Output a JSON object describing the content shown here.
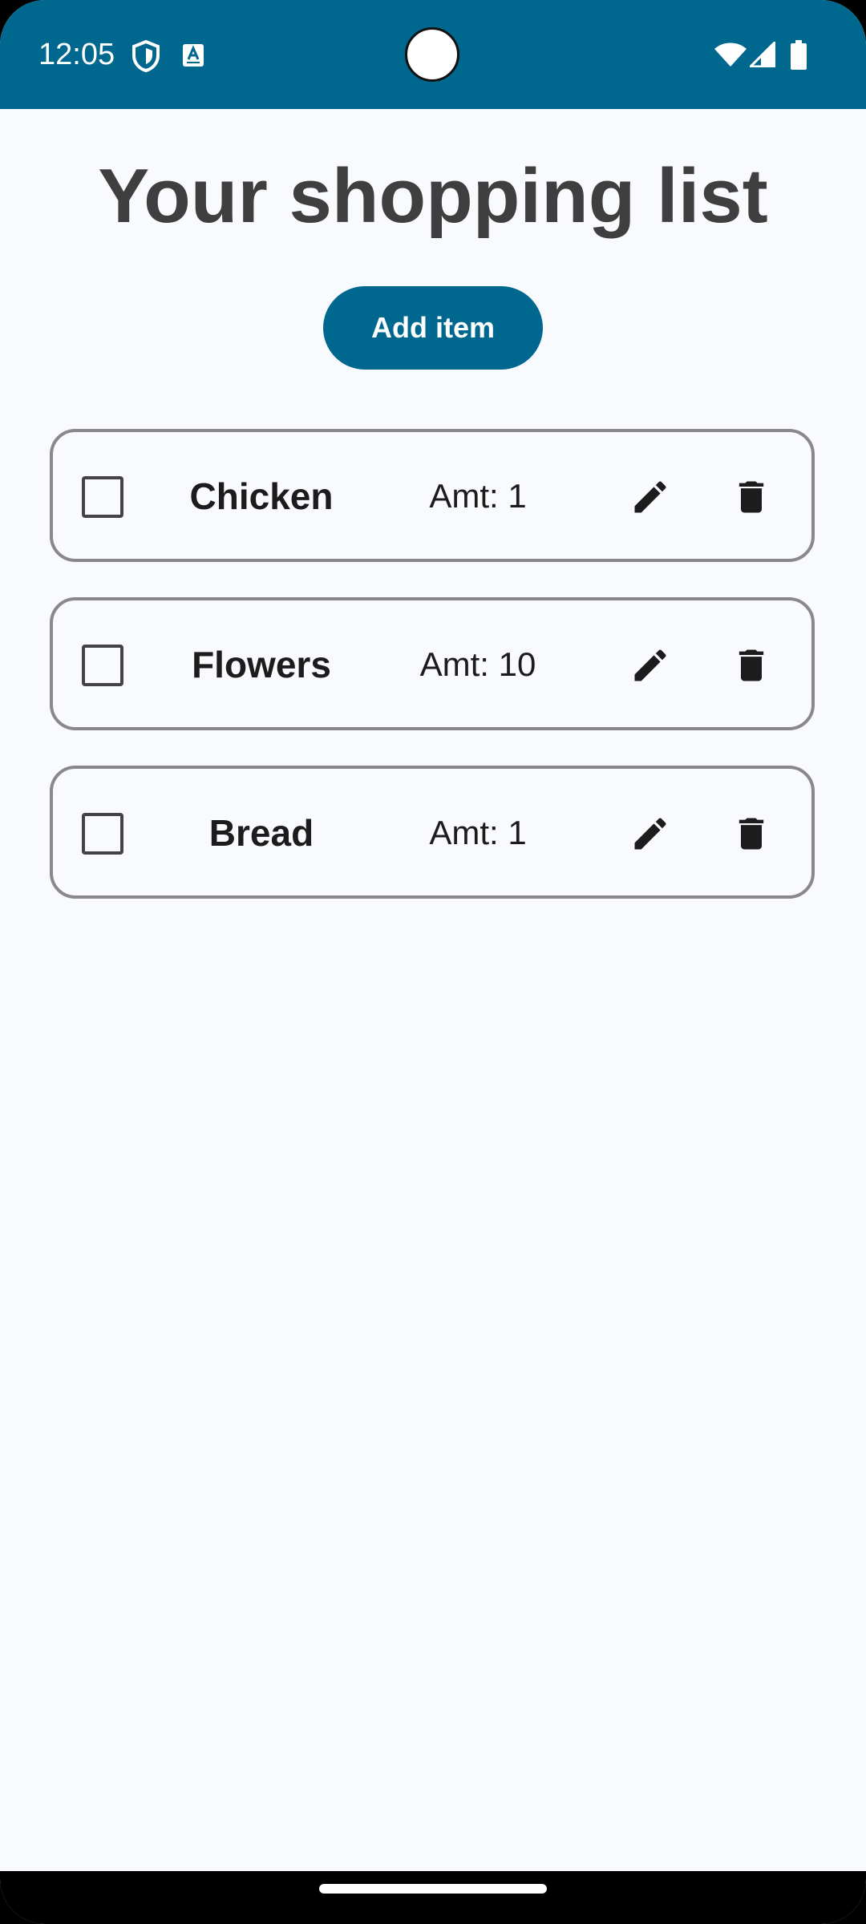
{
  "status_bar": {
    "time": "12:05",
    "left_icons": [
      "shield-icon",
      "keyboard-a-icon"
    ],
    "right_icons": [
      "wifi-icon",
      "cell-signal-icon",
      "battery-icon"
    ],
    "color": "#00688f"
  },
  "page": {
    "title": "Your shopping list",
    "add_button_label": "Add item",
    "accent_color": "#00688f"
  },
  "items": [
    {
      "name": "Chicken",
      "amount": "Amt: 1",
      "checked": false
    },
    {
      "name": "Flowers",
      "amount": "Amt: 10",
      "checked": false
    },
    {
      "name": "Bread",
      "amount": "Amt: 1",
      "checked": false
    }
  ],
  "item_icons": {
    "edit": "pencil-icon",
    "delete": "trash-icon"
  }
}
